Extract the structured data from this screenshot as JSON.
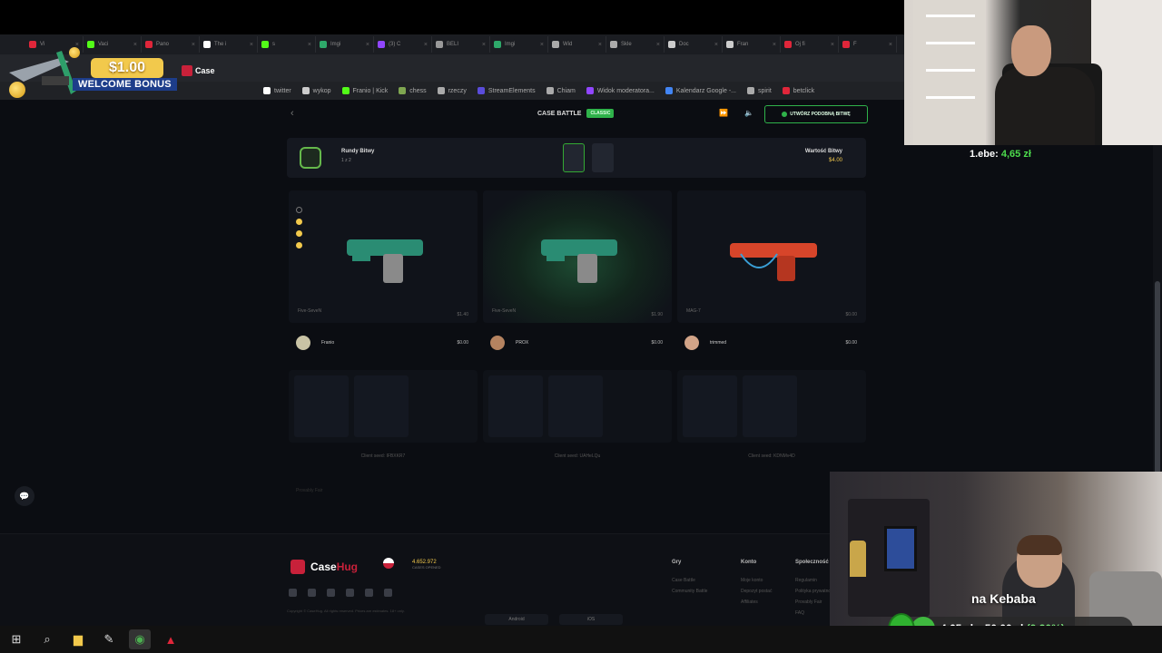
{
  "browser": {
    "tabs": [
      {
        "label": "Vi",
        "color": "#e0263a"
      },
      {
        "label": "Vaci",
        "color": "#53fc18"
      },
      {
        "label": "Pano",
        "color": "#e0263a"
      },
      {
        "label": "The i",
        "color": "#ffffff"
      },
      {
        "label": "s",
        "color": "#53fc18"
      },
      {
        "label": "Imgi",
        "color": "#2ea86a"
      },
      {
        "label": "(3) C",
        "color": "#9146ff"
      },
      {
        "label": "BELI",
        "color": "#999999"
      },
      {
        "label": "Imgi",
        "color": "#2ea86a"
      },
      {
        "label": "Wid",
        "color": "#aaaaaa"
      },
      {
        "label": "Skle",
        "color": "#aaaaaa"
      },
      {
        "label": "Doc",
        "color": "#cccccc"
      },
      {
        "label": "Fran",
        "color": "#cccccc"
      },
      {
        "label": "Oj fi",
        "color": "#e0263a"
      },
      {
        "label": "F",
        "color": "#e0263a"
      }
    ],
    "bookmarks": [
      {
        "label": "twitter",
        "color": "#ffffff"
      },
      {
        "label": "wykop",
        "color": "#cccccc"
      },
      {
        "label": "Franio | Kick",
        "color": "#53fc18"
      },
      {
        "label": "chess",
        "color": "#7fa650"
      },
      {
        "label": "rzeczy",
        "color": "#aaaaaa"
      },
      {
        "label": "StreamElements",
        "color": "#5a4cdb"
      },
      {
        "label": "Chiam",
        "color": "#aaaaaa"
      },
      {
        "label": "Widok moderatora...",
        "color": "#9146ff"
      },
      {
        "label": "Kalendarz Google -...",
        "color": "#4285f4"
      },
      {
        "label": "spirit",
        "color": "#aaaaaa"
      },
      {
        "label": "betclick",
        "color": "#e0263a"
      }
    ]
  },
  "banner": {
    "amount": "$1.00",
    "text": "WELCOME BONUS",
    "brand": "Case"
  },
  "battle": {
    "back": "‹",
    "title": "CASE BATTLE",
    "badge": "CLASSIC",
    "sound_icon": "speaker-icon",
    "create_button": "UTWÓRZ PODOBNĄ BITWĘ",
    "rounds_label": "Rundy Bitwy",
    "rounds_value": "1 z 2",
    "value_label": "Wartość Bitwy",
    "value_amount": "$4.00",
    "slots": [
      {
        "item": "Five-SeveN",
        "price": "$1.40",
        "win": false
      },
      {
        "item": "Five-SeveN",
        "price": "$1.90",
        "win": true
      },
      {
        "item": "MAG-7",
        "price": "$0.00",
        "win": false
      }
    ],
    "players": [
      {
        "name": "Franio",
        "score": "$0.00"
      },
      {
        "name": "PROX",
        "score": "$0.00"
      },
      {
        "name": "trimmed",
        "score": "$0.00"
      }
    ],
    "client_seeds": [
      "Client seed: IFBXKR7",
      "Client seed: UAHeLQu",
      "Client seed: KDNMv4D"
    ],
    "provably": "Provably Fair"
  },
  "footer": {
    "brand_a": "Case",
    "brand_b": "Hug",
    "online": "4.652.972",
    "online_label": "CASES OPENED",
    "copyright": "Copyright © CaseHug. All rights reserved. Prices are estimates. 18+ only.",
    "app_android": "Android",
    "app_ios": "iOS",
    "cols": [
      {
        "title": "Gry",
        "links": [
          "Case Battle",
          "Community Battle"
        ]
      },
      {
        "title": "Konto",
        "links": [
          "Moje konto",
          "Depozyt postać",
          "Affiliates"
        ]
      },
      {
        "title": "Społeczność",
        "links": [
          "Regulamin",
          "Polityka prywatności",
          "Provably Fair",
          "FAQ"
        ]
      }
    ]
  },
  "stream": {
    "donation_name": "1.ebe:",
    "donation_amount": "4,65 zł",
    "goal_title": "na Kebaba",
    "goal_progress": "4,65 zł z 50,00 zł",
    "goal_percent": "(9.30%)",
    "goal_fraction": 0.093
  },
  "taskbar": {
    "items": [
      "windows-icon",
      "search-icon",
      "file-explorer-icon",
      "app-icon",
      "chrome-icon",
      "app-red-icon"
    ]
  }
}
